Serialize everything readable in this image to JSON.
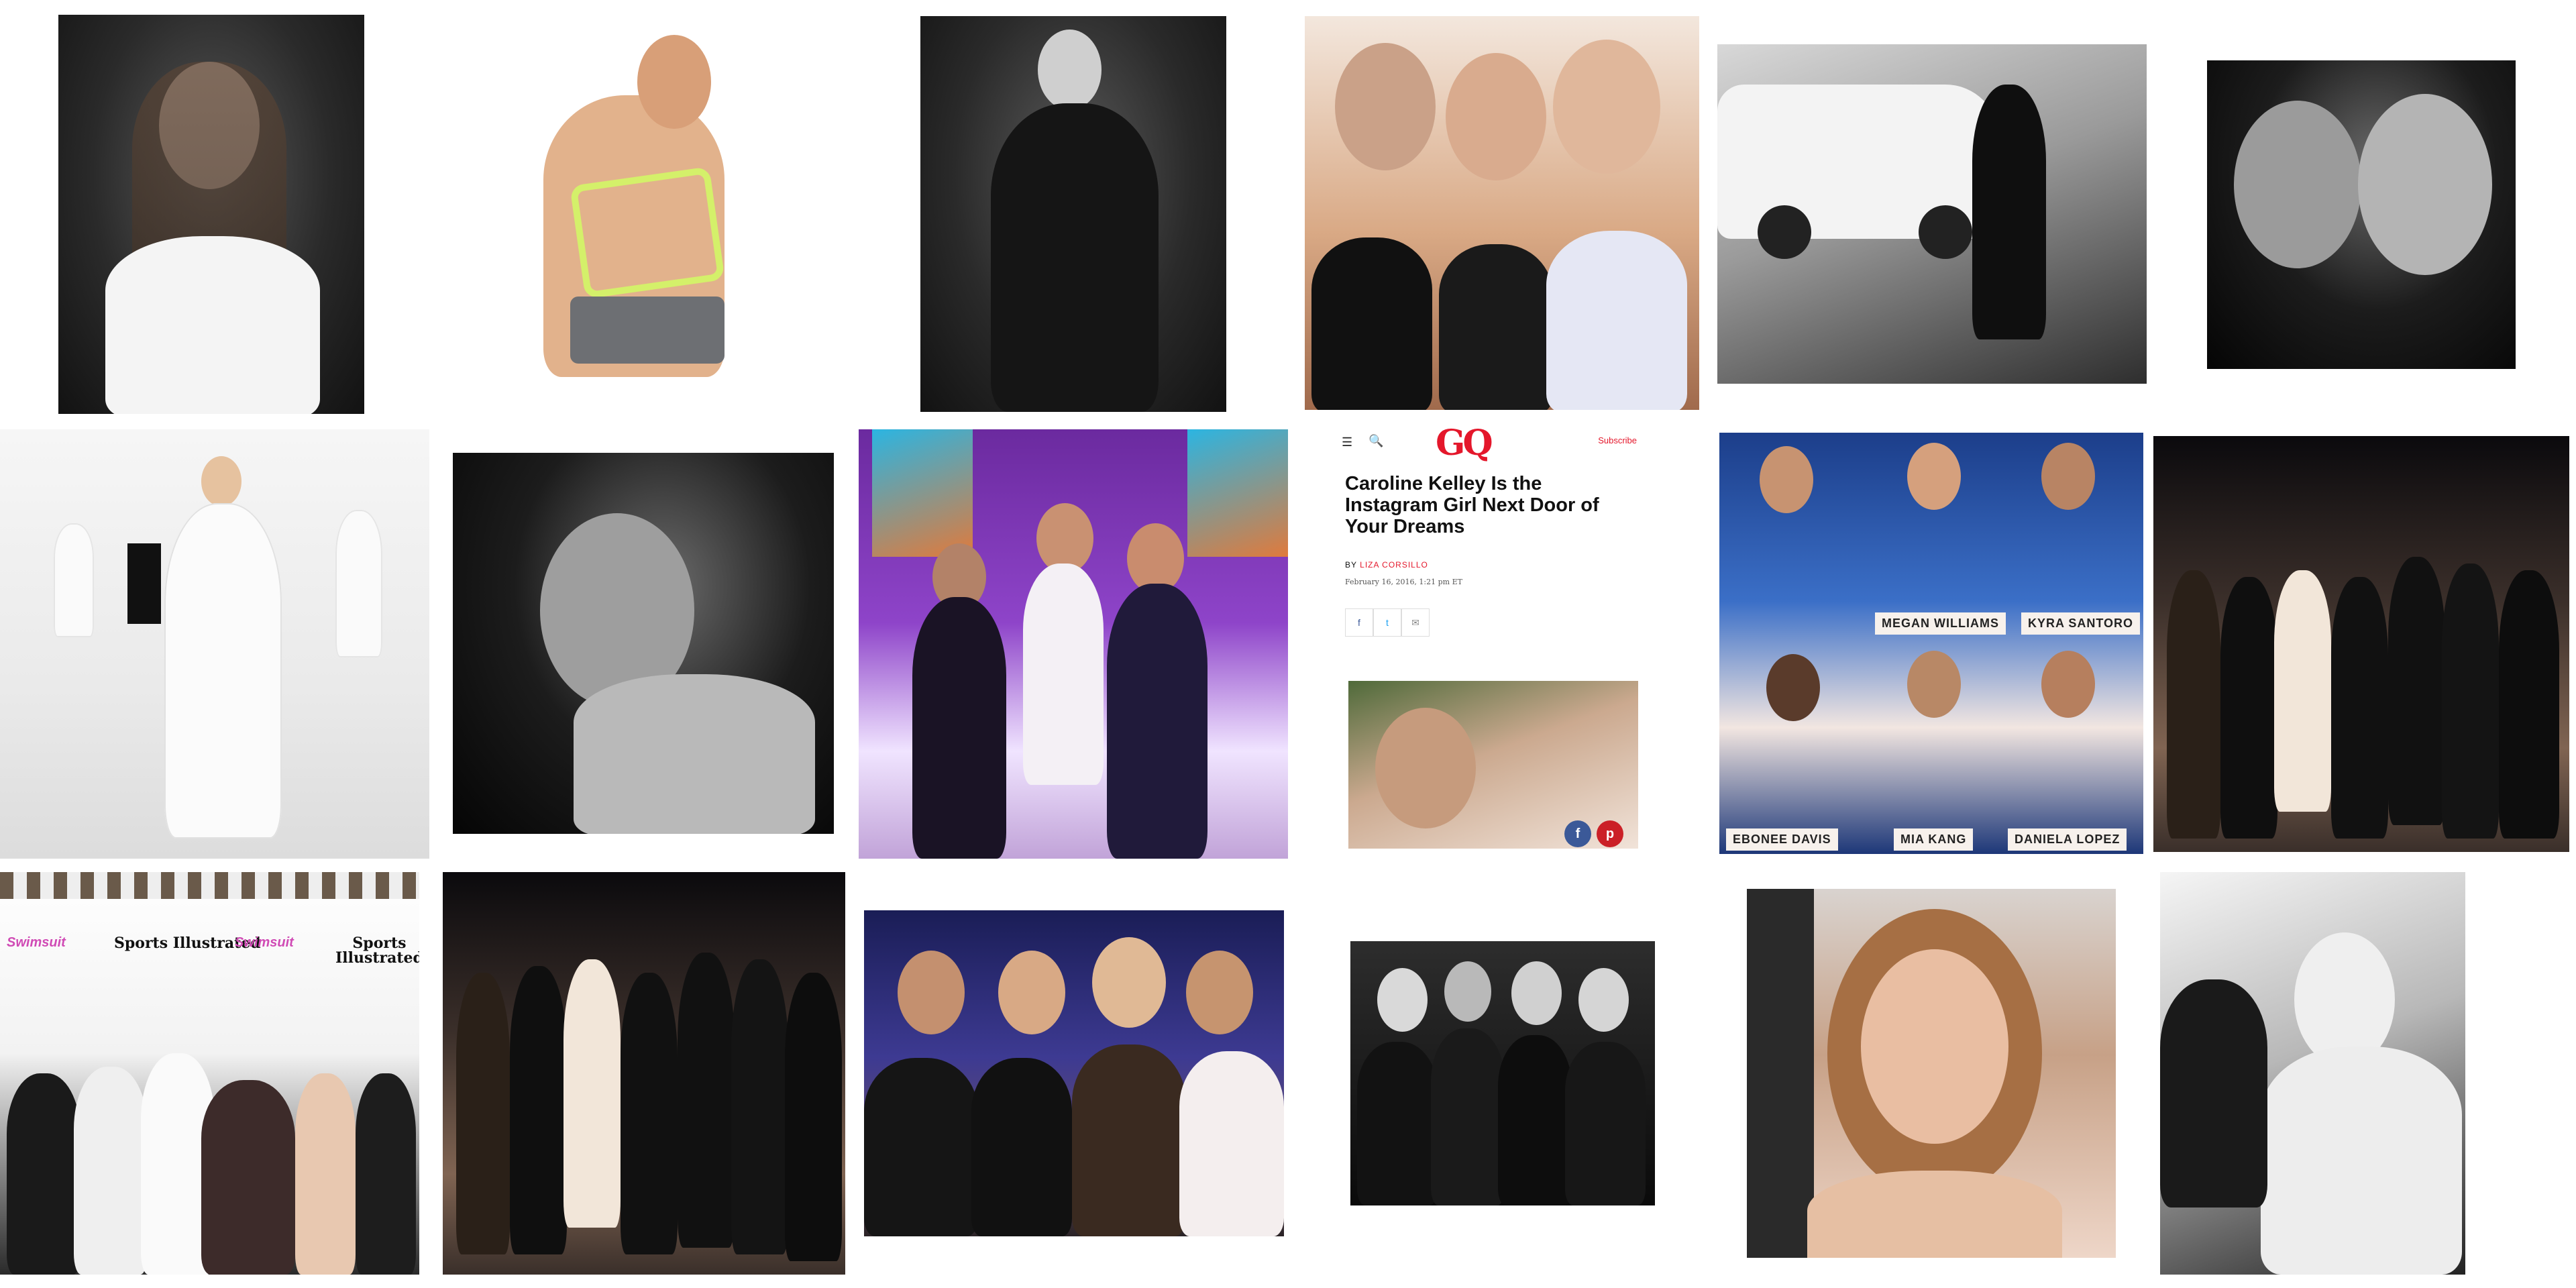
{
  "gq_card": {
    "logo": "GQ",
    "subscribe": "Subscribe",
    "title": "Caroline Kelley Is the Instagram Girl Next Door of Your Dreams",
    "byline_prefix": "BY",
    "author": "LIZA CORSILLO",
    "date": "February 16, 2016, 1:21 pm ET",
    "share_icons": [
      "f",
      "t",
      "✉"
    ]
  },
  "name_plates": [
    "MEGAN WILLIAMS",
    "KYRA SANTORO",
    "EBONEE DAVIS",
    "MIA KANG",
    "DANIELA LOPEZ"
  ],
  "backdrop": {
    "brand": "Sports Illustrated",
    "sub_brand": "Swimsuit"
  }
}
